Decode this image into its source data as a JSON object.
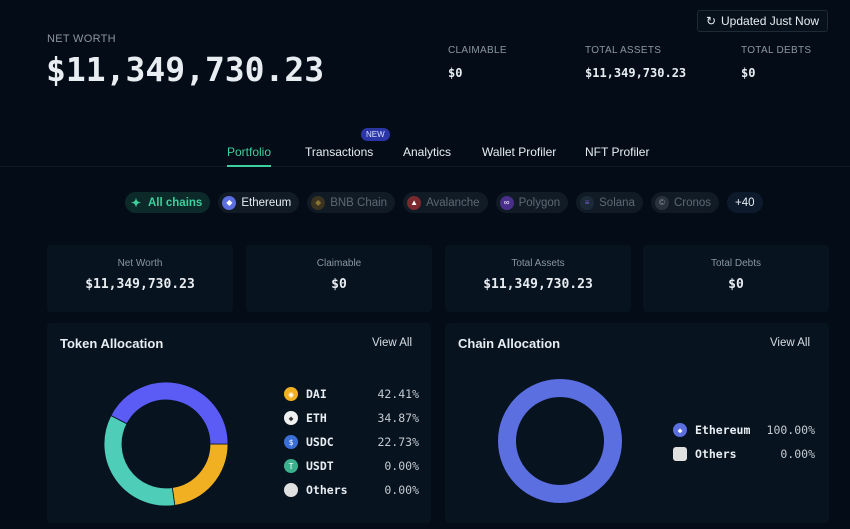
{
  "header": {
    "updated_label": "Updated Just Now",
    "net_worth_label": "NET WORTH",
    "net_worth": "$11,349,730.23",
    "claimable_label": "CLAIMABLE",
    "claimable": "$0",
    "total_assets_label": "TOTAL ASSETS",
    "total_assets": "$11,349,730.23",
    "total_debts_label": "TOTAL DEBTS",
    "total_debts": "$0"
  },
  "tabs": [
    {
      "label": "Portfolio"
    },
    {
      "label": "Transactions",
      "badge": "NEW"
    },
    {
      "label": "Analytics"
    },
    {
      "label": "Wallet Profiler"
    },
    {
      "label": "NFT Profiler"
    }
  ],
  "chains": [
    {
      "label": "All chains"
    },
    {
      "label": "Ethereum"
    },
    {
      "label": "BNB Chain"
    },
    {
      "label": "Avalanche"
    },
    {
      "label": "Polygon"
    },
    {
      "label": "Solana"
    },
    {
      "label": "Cronos"
    },
    {
      "label": "+40"
    }
  ],
  "summary": [
    {
      "title": "Net Worth",
      "value": "$11,349,730.23"
    },
    {
      "title": "Claimable",
      "value": "$0"
    },
    {
      "title": "Total Assets",
      "value": "$11,349,730.23"
    },
    {
      "title": "Total Debts",
      "value": "$0"
    }
  ],
  "view_all": "View All",
  "chart_data": [
    {
      "type": "pie",
      "title": "Token Allocation",
      "categories": [
        "DAI",
        "ETH",
        "USDC",
        "USDT",
        "Others"
      ],
      "values": [
        42.41,
        34.87,
        22.73,
        0,
        0
      ],
      "labels": [
        "42.41%",
        "34.87%",
        "22.73%",
        "0.00%",
        "0.00%"
      ],
      "colors": [
        "#5a5cf5",
        "#4ecdb8",
        "#f0b022",
        "#3ab08c",
        "#e0e0e0"
      ]
    },
    {
      "type": "pie",
      "title": "Chain Allocation",
      "categories": [
        "Ethereum",
        "Others"
      ],
      "values": [
        100,
        0
      ],
      "labels": [
        "100.00%",
        "0.00%"
      ],
      "colors": [
        "#5b6fe0",
        "#e0e0e0"
      ]
    }
  ]
}
